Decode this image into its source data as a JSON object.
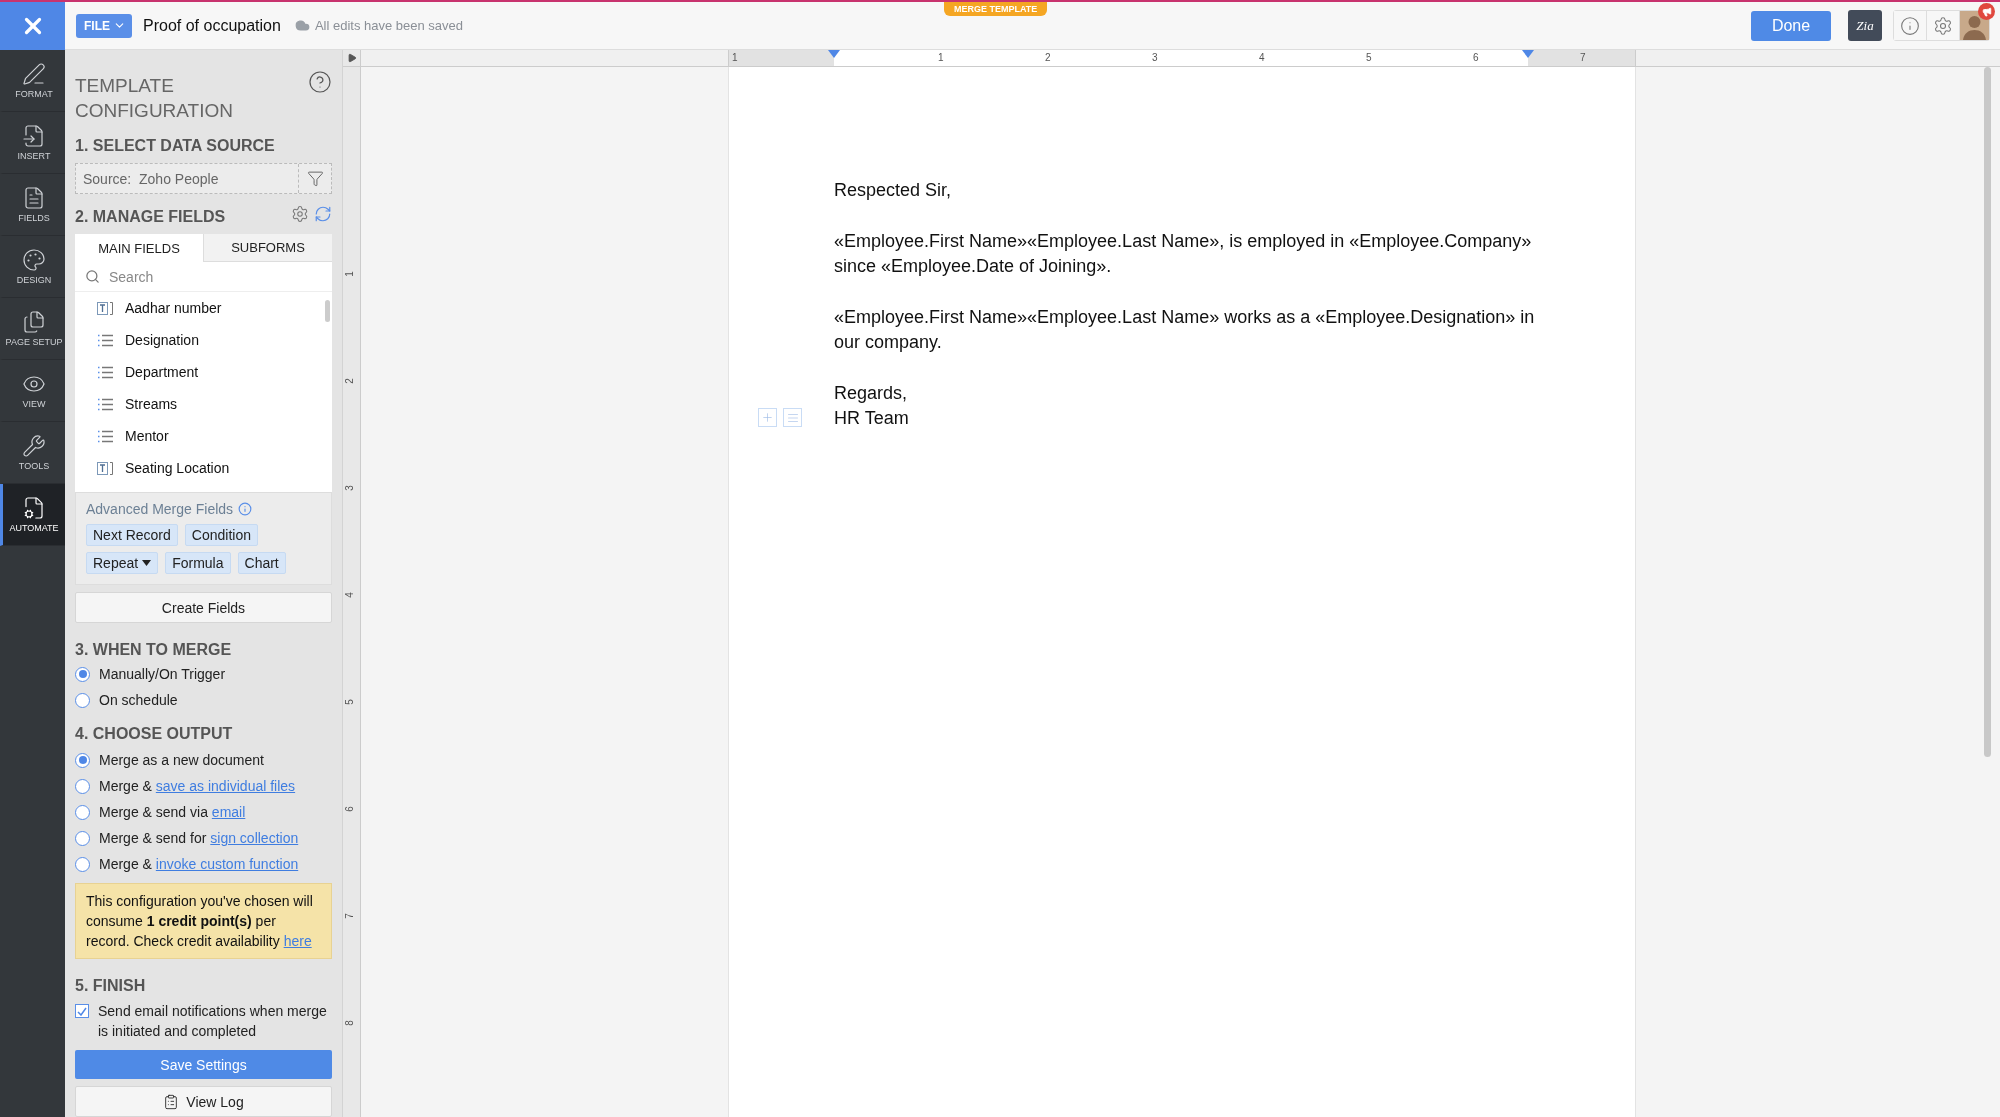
{
  "top_bar": {
    "file_menu": "FILE",
    "document_title": "Proof of occupation",
    "save_status": "All edits have been saved",
    "mode_badge": "MERGE TEMPLATE",
    "done_button": "Done",
    "zia_button": "Zia",
    "notification_badge": true
  },
  "sidebar": {
    "items": [
      {
        "kind": "format",
        "label": "FORMAT",
        "selected": false
      },
      {
        "kind": "insert",
        "label": "INSERT",
        "selected": false
      },
      {
        "kind": "fields",
        "label": "FIELDS",
        "selected": false
      },
      {
        "kind": "design",
        "label": "DESIGN",
        "selected": false
      },
      {
        "kind": "page",
        "label": "PAGE SETUP",
        "selected": false
      },
      {
        "kind": "view",
        "label": "VIEW",
        "selected": false
      },
      {
        "kind": "tools",
        "label": "TOOLS",
        "selected": false
      },
      {
        "kind": "automate",
        "label": "AUTOMATE",
        "selected": true
      }
    ]
  },
  "panel": {
    "title": "TEMPLATE CONFIGURATION",
    "data_source": {
      "heading": "1. SELECT DATA SOURCE",
      "label": "Source:",
      "value": "Zoho People"
    },
    "manage_fields": {
      "heading": "2. MANAGE FIELDS",
      "tabs": [
        {
          "label": "MAIN FIELDS",
          "selected": true
        },
        {
          "label": "SUBFORMS",
          "selected": false
        }
      ],
      "search": {
        "placeholder": "Search"
      },
      "fields": [
        {
          "kind": "text",
          "label": "Aadhar number"
        },
        {
          "kind": "list",
          "label": "Designation"
        },
        {
          "kind": "list",
          "label": "Department"
        },
        {
          "kind": "list",
          "label": "Streams"
        },
        {
          "kind": "list",
          "label": "Mentor"
        },
        {
          "kind": "text",
          "label": "Seating Location"
        }
      ],
      "advanced": {
        "heading": "Advanced Merge Fields",
        "chips": [
          {
            "label": "Next Record",
            "dropdown": false
          },
          {
            "label": "Condition",
            "dropdown": false
          },
          {
            "label": "Repeat",
            "dropdown": true
          },
          {
            "label": "Formula",
            "dropdown": false
          },
          {
            "label": "Chart",
            "dropdown": false
          }
        ]
      },
      "create_button": "Create Fields"
    },
    "when_to_merge": {
      "heading": "3. WHEN TO MERGE",
      "options": [
        {
          "text": "Manually/On Trigger",
          "selected": true
        },
        {
          "text": "On schedule",
          "selected": false
        }
      ]
    },
    "output": {
      "heading": "4. CHOOSE OUTPUT",
      "options": [
        {
          "text": "Merge as a new document",
          "selected": true
        },
        {
          "text": "Merge & ",
          "link": "save as individual files",
          "selected": false
        },
        {
          "text": "Merge & send via ",
          "link": "email",
          "selected": false
        },
        {
          "text": "Merge & send for ",
          "link": "sign collection",
          "selected": false
        },
        {
          "text": "Merge & ",
          "link": "invoke custom function",
          "selected": false
        }
      ],
      "note": {
        "text": "This configuration you've chosen will consume **1 credit point(s)** per record. Check credit availability ",
        "link": "here"
      }
    },
    "finish": {
      "heading": "5. FINISH",
      "notify": {
        "label": "Send email notifications when merge is initiated and completed",
        "checked": true
      },
      "save_button": "Save Settings",
      "log_button": "View Log"
    }
  },
  "ruler": {
    "horizontal": [
      "1",
      "1",
      "2",
      "3",
      "4",
      "5",
      "6",
      "7"
    ],
    "vertical": [
      "1",
      "2",
      "3",
      "4",
      "5",
      "6",
      "7",
      "8"
    ]
  },
  "document": {
    "paragraphs": [
      {
        "lines": [
          "Respected Sir,"
        ]
      },
      {
        "lines": [
          "«Employee.First Name»«Employee.Last Name», is employed in «Employee.Company»",
          "since «Employee.Date of Joining»."
        ]
      },
      {
        "lines": [
          "«Employee.First Name»«Employee.Last Name» works as a «Employee.Designation» in",
          "our company."
        ]
      },
      {
        "lines": [
          "Regards,",
          "HR Team"
        ]
      }
    ]
  }
}
